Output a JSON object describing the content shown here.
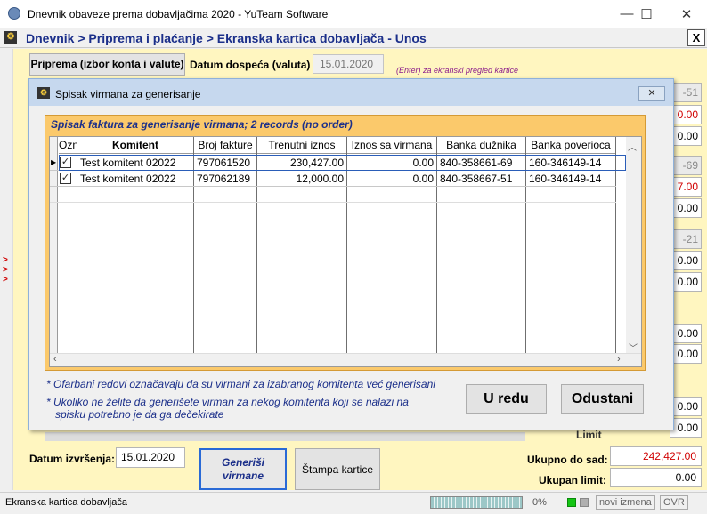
{
  "window": {
    "title": "Dnevnik obaveze prema dobavljačima 2020 - YuTeam Software",
    "min": "—",
    "max": "☐",
    "close": "✕"
  },
  "module": {
    "title": "Dnevnik > Priprema i plaćanje > Ekranska kartica dobavljača - Unos",
    "close": "X"
  },
  "side_arrows": "> > >",
  "toolbar": {
    "priprema_label": "Priprema (izbor konta i valute)",
    "dospeca_label": "Datum dospeća (valuta)",
    "dospeca_value": "15.01.2020",
    "enter_hint": "(Enter) za ekranski pregled kartice"
  },
  "right_fields": [
    {
      "value": "-51",
      "style": "grey"
    },
    {
      "value": "0.00",
      "style": "red"
    },
    {
      "value": "0.00",
      "style": "plain"
    },
    {
      "value": "-69",
      "style": "grey"
    },
    {
      "value": "7.00",
      "style": "red"
    },
    {
      "value": "0.00",
      "style": "plain"
    },
    {
      "value": "-21",
      "style": "grey"
    },
    {
      "value": "0.00",
      "style": "plain"
    },
    {
      "value": "0.00",
      "style": "plain"
    },
    {
      "value": "0.00",
      "style": "plain"
    },
    {
      "value": "0.00",
      "style": "plain"
    },
    {
      "value": "0.00",
      "style": "plain"
    },
    {
      "value": "0.00",
      "style": "plain"
    }
  ],
  "dialog": {
    "title": "Spisak virmana za generisanje",
    "close": "✕",
    "grid_caption": "Spisak faktura za generisanje virmana; 2 records (no order)",
    "columns": [
      "Ozn",
      "Komitent",
      "Broj fakture",
      "Trenutni iznos",
      "Iznos sa virmana",
      "Banka dužnika",
      "Banka poverioca"
    ],
    "rows": [
      {
        "checked": "✓",
        "komitent": "Test komitent 02022",
        "broj": "797061520",
        "trenutni": "230,427.00",
        "iznos": "0.00",
        "duznik": "840-358661-69",
        "poverilac": "160-346149-14"
      },
      {
        "checked": "✓",
        "komitent": "Test komitent 02022",
        "broj": "797062189",
        "trenutni": "12,000.00",
        "iznos": "0.00",
        "duznik": "840-358667-51",
        "poverilac": "160-346149-14"
      }
    ],
    "note1": "* Ofarbani redovi označavaju da su virmani za izabranog komitenta već generisani",
    "note2_line1": "* Ukoliko ne želite da generišete virman za nekog komitenta koji se nalazi na",
    "note2_line2": "spisku potrebno je da ga dečekirate",
    "ok_label": "U redu",
    "cancel_label": "Odustani"
  },
  "bottom": {
    "izvrsenja_label": "Datum izvršenja:",
    "izvrsenja_value": "15.01.2020",
    "generisi_label": "Generiši virmane",
    "stampa_label": "Štampa kartice",
    "ukupno_label": "Ukupno do sad:",
    "ukupno_value": "242,427.00",
    "limit_label": "Ukupan limit:",
    "limit_value": "0.00",
    "limit_behind": "Limit"
  },
  "status": {
    "text": "Ekranska kartica dobavljača",
    "progress_pct": "0%",
    "progress_fraction": 0,
    "mode": "novi izmena",
    "ovr": "OVR"
  },
  "colors": {
    "accent": "#1b2f8a",
    "panel": "#fff6c0",
    "grid_frame": "#fbc96b",
    "red": "#d00000"
  }
}
